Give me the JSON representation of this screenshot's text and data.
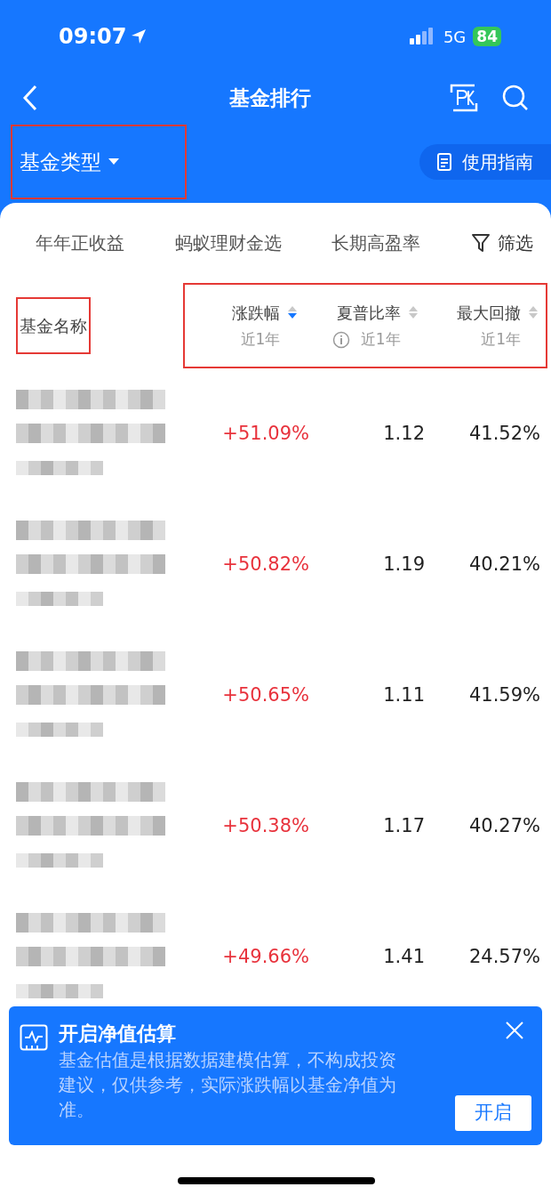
{
  "status_bar": {
    "time": "09:07",
    "network": "5G",
    "battery": "84"
  },
  "nav": {
    "title": "基金排行"
  },
  "filter": {
    "type_label": "基金类型",
    "guide": "使用指南"
  },
  "tabs": [
    {
      "label": "年年正收益",
      "selected": false
    },
    {
      "label": "蚂蚁理财金选",
      "selected": false
    },
    {
      "label": "长期高盈率",
      "selected": false
    }
  ],
  "filter_button": "筛选",
  "table": {
    "name_header": "基金名称",
    "columns": [
      {
        "label": "涨跌幅",
        "sub": "近1年",
        "sorted": true,
        "info": false
      },
      {
        "label": "夏普比率",
        "sub": "近1年",
        "sorted": false,
        "info": true
      },
      {
        "label": "最大回撤",
        "sub": "近1年",
        "sorted": false,
        "info": false
      }
    ],
    "rows": [
      {
        "change": "+51.09%",
        "sharpe": "1.12",
        "drawdown": "41.52%"
      },
      {
        "change": "+50.82%",
        "sharpe": "1.19",
        "drawdown": "40.21%"
      },
      {
        "change": "+50.65%",
        "sharpe": "1.11",
        "drawdown": "41.59%"
      },
      {
        "change": "+50.38%",
        "sharpe": "1.17",
        "drawdown": "40.27%"
      },
      {
        "change": "+49.66%",
        "sharpe": "1.41",
        "drawdown": "24.57%"
      }
    ]
  },
  "banner": {
    "title": "开启净值估算",
    "text": "基金估值是根据数据建模估算，不构成投资建议，仅供参考，实际涨跌幅以基金净值为准。",
    "button": "开启"
  }
}
